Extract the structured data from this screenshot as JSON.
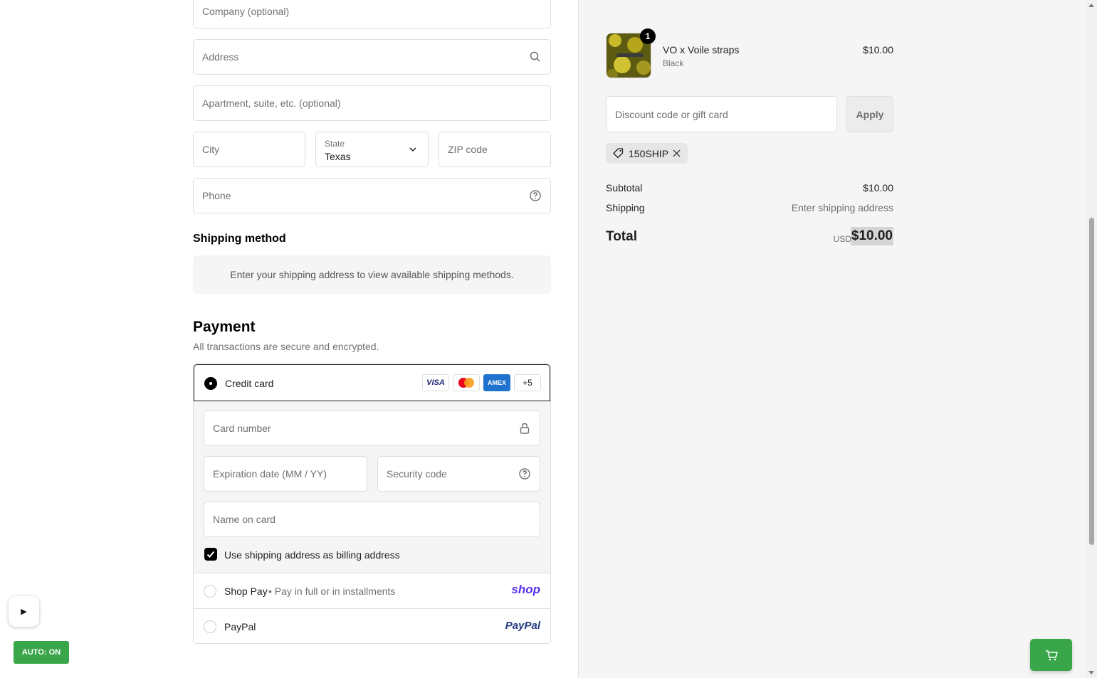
{
  "form": {
    "company_placeholder": "Company (optional)",
    "address_placeholder": "Address",
    "apartment_placeholder": "Apartment, suite, etc. (optional)",
    "city_placeholder": "City",
    "state_label": "State",
    "state_value": "Texas",
    "zip_placeholder": "ZIP code",
    "phone_placeholder": "Phone"
  },
  "shipping": {
    "heading": "Shipping method",
    "message": "Enter your shipping address to view available shipping methods."
  },
  "payment": {
    "heading": "Payment",
    "subtext": "All transactions are secure and encrypted.",
    "credit_card": {
      "label": "Credit card",
      "logos": [
        "VISA",
        "Mastercard",
        "AMEX"
      ],
      "more_count": "+5",
      "card_number_placeholder": "Card number",
      "expiration_placeholder": "Expiration date (MM / YY)",
      "security_placeholder": "Security code",
      "name_placeholder": "Name on card",
      "billing_checkbox_label": "Use shipping address as billing address",
      "billing_checked": true
    },
    "shop_pay": {
      "label": "Shop Pay",
      "sub": "• Pay in full or in installments",
      "logo": "shop"
    },
    "paypal": {
      "label": "PayPal",
      "logo": "PayPal"
    }
  },
  "summary": {
    "item": {
      "quantity": "1",
      "name": "VO x Voile straps",
      "variant": "Black",
      "price": "$10.00"
    },
    "discount_placeholder": "Discount code or gift card",
    "apply_label": "Apply",
    "applied_code": "150SHIP",
    "subtotal_label": "Subtotal",
    "subtotal_value": "$10.00",
    "shipping_label": "Shipping",
    "shipping_value": "Enter shipping address",
    "total_label": "Total",
    "total_currency": "USD",
    "total_value": "$10.00"
  },
  "overlay": {
    "auto_label": "AUTO: ON",
    "play_glyph": "▶"
  },
  "colors": {
    "accent_green": "#3aa64a",
    "shop_purple": "#5a31f4",
    "paypal_blue": "#253b80",
    "amex_blue": "#1f72cd"
  }
}
